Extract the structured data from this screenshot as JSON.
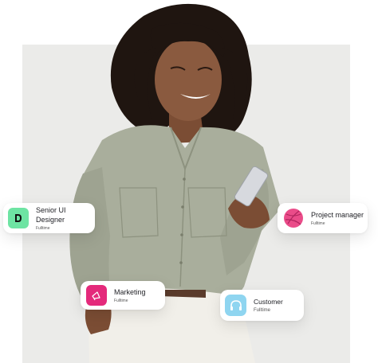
{
  "cards": {
    "designer": {
      "title": "Senior UI Designer",
      "subtitle": "Fulltime",
      "icon": "dribbble-d-icon",
      "color": "#6ee4a3"
    },
    "project_manager": {
      "title": "Project manager",
      "subtitle": "Fulltime",
      "icon": "dribbble-ball-icon",
      "color": "#ea4c89"
    },
    "marketing": {
      "title": "Marketing",
      "subtitle": "Fulltime",
      "icon": "megaphone-icon",
      "color": "#e42a7b"
    },
    "customer": {
      "title": "Customer",
      "subtitle": "Fulltime",
      "icon": "headset-icon",
      "color": "#8fd5f0"
    }
  },
  "colors": {
    "panel_background": "#ebebe9",
    "shirt": "#a9ae9c",
    "skin": "#8a5a3f",
    "hair": "#1f1510"
  }
}
